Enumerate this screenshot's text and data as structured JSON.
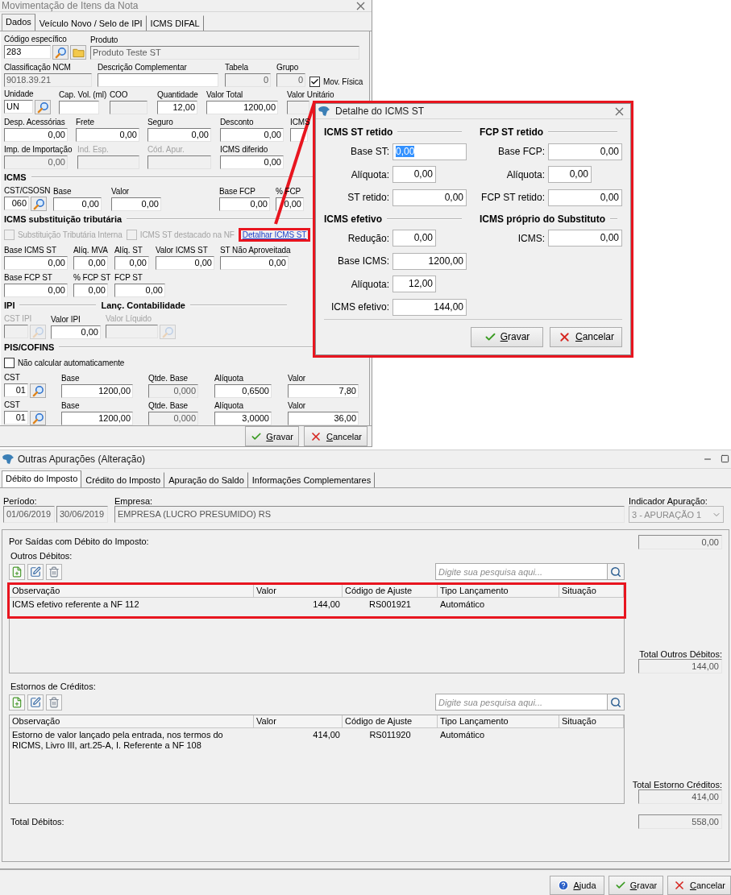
{
  "item_window": {
    "title": "Movimentação de Itens da Nota",
    "tabs": [
      {
        "label": "Dados",
        "selected": true
      },
      {
        "label": "Veículo Novo / Selo de IPI",
        "selected": false
      },
      {
        "label": "ICMS DIFAL",
        "selected": false
      }
    ],
    "content": [
      {
        "kind": "row",
        "fields": [
          {
            "kind": "lookup_folder",
            "label": "Código específico",
            "value": "283",
            "disabled": false,
            "muted": false
          },
          {
            "kind": "text",
            "label": "Produto",
            "value": "Produto Teste ST",
            "disabled": true,
            "muted": false
          }
        ]
      },
      {
        "kind": "row",
        "fields": [
          {
            "kind": "text",
            "label": "Classificação NCM",
            "value": "9018.39.21",
            "disabled": true,
            "muted": false
          },
          {
            "kind": "text",
            "label": "Descrição Complementar",
            "disabled": false,
            "muted": false
          },
          {
            "kind": "number",
            "label": "Tabela",
            "value": "0",
            "disabled": true,
            "muted": false
          },
          {
            "kind": "number",
            "label": "Grupo",
            "value": "0",
            "disabled": true,
            "muted": false
          },
          {
            "kind": "checkbox",
            "label": "Mov. Física",
            "checked": true,
            "disabled": false
          }
        ]
      },
      {
        "kind": "row",
        "fields": [
          {
            "kind": "lookup",
            "label": "Unidade",
            "value": "UN",
            "disabled": false,
            "muted": false
          },
          {
            "kind": "text",
            "label": "Cap. Vol. (ml)",
            "disabled": false,
            "muted": false
          },
          {
            "kind": "text",
            "label": "COO",
            "disabled": true,
            "muted": false
          },
          {
            "kind": "number",
            "label": "Quantidade",
            "value": "12,00",
            "disabled": false,
            "muted": false
          },
          {
            "kind": "number",
            "label": "Valor Total",
            "value": "1200,00",
            "disabled": false,
            "muted": false
          },
          {
            "kind": "number",
            "label": "Valor Unitário",
            "disabled": true,
            "muted": false
          }
        ]
      },
      {
        "kind": "row",
        "fields": [
          {
            "kind": "number",
            "label": "Desp. Acessórias",
            "value": "0,00",
            "disabled": false,
            "muted": false
          },
          {
            "kind": "number",
            "label": "Frete",
            "value": "0,00",
            "disabled": false,
            "muted": false
          },
          {
            "kind": "number",
            "label": "Seguro",
            "value": "0,00",
            "disabled": false,
            "muted": false
          },
          {
            "kind": "number",
            "label": "Desconto",
            "value": "0,00",
            "disabled": false,
            "muted": false
          },
          {
            "kind": "number",
            "label": "ICMS",
            "disabled": false,
            "muted": false
          }
        ]
      },
      {
        "kind": "row",
        "fields": [
          {
            "kind": "number",
            "label": "Imp. de Importação",
            "value": "0,00",
            "disabled": true,
            "muted": false
          },
          {
            "kind": "text",
            "label": "Ind. Esp.",
            "disabled": true,
            "muted": true
          },
          {
            "kind": "text",
            "label": "Cód. Apur.",
            "disabled": true,
            "muted": true
          },
          {
            "kind": "number",
            "label": "ICMS diferido",
            "value": "0,00",
            "disabled": false,
            "muted": false
          }
        ]
      },
      {
        "kind": "section",
        "title": "ICMS"
      },
      {
        "kind": "row",
        "fields": [
          {
            "kind": "lookup",
            "label": "CST/CSOSN",
            "value": "060",
            "disabled": false,
            "muted": false
          },
          {
            "kind": "number",
            "label": "Base",
            "value": "0,00",
            "disabled": false,
            "muted": false
          },
          {
            "kind": "number",
            "label": "Valor",
            "value": "0,00",
            "disabled": false,
            "muted": false
          },
          {
            "kind": "number",
            "label": "Base FCP",
            "value": "0,00",
            "disabled": false,
            "muted": false
          },
          {
            "kind": "number",
            "label": "% FCP",
            "value": "0,00",
            "disabled": false,
            "muted": false
          }
        ]
      },
      {
        "kind": "section",
        "title": "ICMS substituição tributária"
      },
      {
        "kind": "options",
        "fields": [
          {
            "kind": "checkbox",
            "label": "Substituição Tributária Interna",
            "checked": false,
            "disabled": true
          },
          {
            "kind": "checkbox",
            "label": "ICMS ST destacado na NF",
            "checked": false,
            "disabled": true
          },
          {
            "kind": "link",
            "label": "Detalhar ICMS ST",
            "annotated": true
          }
        ]
      },
      {
        "kind": "row",
        "fields": [
          {
            "kind": "number",
            "label": "Base ICMS ST",
            "value": "0,00",
            "disabled": false,
            "muted": false
          },
          {
            "kind": "number",
            "label": "Alíq. MVA",
            "value": "0,00",
            "disabled": false,
            "muted": false
          },
          {
            "kind": "number",
            "label": "Alíq. ST",
            "value": "0,00",
            "disabled": false,
            "muted": false
          },
          {
            "kind": "number",
            "label": "Valor ICMS ST",
            "value": "0,00",
            "disabled": false,
            "muted": false
          },
          {
            "kind": "number",
            "label": "ST Não Aproveitada",
            "value": "0,00",
            "disabled": false,
            "muted": false
          }
        ]
      },
      {
        "kind": "row",
        "fields": [
          {
            "kind": "number",
            "label": "Base FCP ST",
            "value": "0,00",
            "disabled": false,
            "muted": false
          },
          {
            "kind": "number",
            "label": "% FCP ST",
            "value": "0,00",
            "disabled": false,
            "muted": false
          },
          {
            "kind": "number",
            "label": "FCP ST",
            "value": "0,00",
            "disabled": false,
            "muted": false
          }
        ]
      },
      {
        "kind": "section_pair",
        "titles": [
          "IPI",
          "Lanç. Contabilidade"
        ]
      },
      {
        "kind": "row",
        "fields": [
          {
            "kind": "lookup",
            "label": "CST IPI",
            "disabled": true,
            "muted": true
          },
          {
            "kind": "number",
            "label": "Valor IPI",
            "value": "0,00",
            "disabled": false,
            "muted": false
          },
          {
            "kind": "lookup",
            "label": "Valor Líquido",
            "disabled": true,
            "muted": true
          }
        ]
      },
      {
        "kind": "section",
        "title": "PIS/COFINS"
      },
      {
        "kind": "options",
        "fields": [
          {
            "kind": "checkbox",
            "label": "Não calcular automaticamente",
            "checked": false,
            "disabled": false
          }
        ]
      },
      {
        "kind": "row",
        "fields": [
          {
            "kind": "lookup",
            "label": "CST",
            "value": "01",
            "disabled": false,
            "muted": false
          },
          {
            "kind": "number",
            "label": "Base",
            "value": "1200,00",
            "disabled": false,
            "muted": false
          },
          {
            "kind": "number",
            "label": "Qtde. Base",
            "value": "0,000",
            "disabled": true,
            "muted": false
          },
          {
            "kind": "number",
            "label": "Alíquota",
            "value": "0,6500",
            "disabled": false,
            "muted": false
          },
          {
            "kind": "number",
            "label": "Valor",
            "value": "7,80",
            "disabled": false,
            "muted": false
          }
        ]
      },
      {
        "kind": "row",
        "fields": [
          {
            "kind": "lookup",
            "label": "CST",
            "value": "01",
            "disabled": false,
            "muted": false
          },
          {
            "kind": "number",
            "label": "Base",
            "value": "1200,00",
            "disabled": false,
            "muted": false
          },
          {
            "kind": "number",
            "label": "Qtde. Base",
            "value": "0,000",
            "disabled": true,
            "muted": false
          },
          {
            "kind": "number",
            "label": "Alíquota",
            "value": "3,0000",
            "disabled": false,
            "muted": false
          },
          {
            "kind": "number",
            "label": "Valor",
            "value": "36,00",
            "disabled": false,
            "muted": false
          }
        ]
      }
    ],
    "buttons": [
      {
        "kind": "save",
        "label": "Gravar"
      },
      {
        "kind": "cancel",
        "label": "Cancelar"
      }
    ]
  },
  "detail_dialog": {
    "title": "Detalhe do ICMS ST",
    "columns": [
      {
        "sections": [
          {
            "title": "ICMS ST retido",
            "fields": [
              {
                "label": "Base ST:",
                "value": "0,00",
                "kind": "amount",
                "selected": true
              },
              {
                "label": "Alíquota:",
                "value": "0,00",
                "kind": "percent",
                "selected": false
              },
              {
                "label": "ST retido:",
                "value": "0,00",
                "kind": "amount",
                "selected": false
              }
            ]
          },
          {
            "title": "ICMS efetivo",
            "fields": [
              {
                "label": "Redução:",
                "value": "0,00",
                "kind": "percent",
                "selected": false
              },
              {
                "label": "Base ICMS:",
                "value": "1200,00",
                "kind": "amount",
                "selected": false
              },
              {
                "label": "Alíquota:",
                "value": "12,00",
                "kind": "percent",
                "selected": false
              },
              {
                "label": "ICMS efetivo:",
                "value": "144,00",
                "kind": "amount",
                "selected": false
              }
            ]
          }
        ]
      },
      {
        "sections": [
          {
            "title": "FCP ST retido",
            "fields": [
              {
                "label": "Base FCP:",
                "value": "0,00",
                "kind": "amount",
                "selected": false
              },
              {
                "label": "Alíquota:",
                "value": "0,00",
                "kind": "percent",
                "selected": false
              },
              {
                "label": "FCP ST retido:",
                "value": "0,00",
                "kind": "amount",
                "selected": false
              }
            ]
          },
          {
            "title": "ICMS próprio do Substituto",
            "fields": [
              {
                "label": "ICMS:",
                "value": "0,00",
                "kind": "amount",
                "selected": false
              }
            ]
          }
        ]
      }
    ],
    "buttons": [
      {
        "kind": "save",
        "label": "Gravar"
      },
      {
        "kind": "cancel",
        "label": "Cancelar"
      }
    ]
  },
  "apuracao_window": {
    "title": "Outras Apurações (Alteração)",
    "tabs": [
      {
        "label": "Débito do Imposto",
        "selected": true
      },
      {
        "label": "Crédito do Imposto",
        "selected": false
      },
      {
        "label": "Apuração do Saldo",
        "selected": false
      },
      {
        "label": "Informações Complementares",
        "selected": false
      }
    ],
    "periodo": {
      "label": "Período:",
      "start": "01/06/2019",
      "end": "30/06/2019"
    },
    "empresa": {
      "label": "Empresa:",
      "value": "EMPRESA (LUCRO PRESUMIDO) RS"
    },
    "indicador": {
      "label": "Indicador Apuração:",
      "value": "3 - APURAÇÃO 1"
    },
    "heading": "Por Saídas com Débito do Imposto:",
    "heading_total": "0,00",
    "groups": [
      {
        "label": "Outros Débitos:",
        "search_placeholder": "Digite sua pesquisa aqui...",
        "columns": [
          "Observação",
          "Valor",
          "Código de Ajuste",
          "Tipo Lançamento",
          "Situação"
        ],
        "rows": [
          {
            "cells": [
              "ICMS efetivo referente a NF 112",
              "144,00",
              "RS001921",
              "Automático"
            ]
          }
        ],
        "annotated": true,
        "total_label": "Total Outros Débitos:",
        "total": "144,00"
      },
      {
        "label": "Estornos de Créditos:",
        "search_placeholder": "Digite sua pesquisa aqui...",
        "columns": [
          "Observação",
          "Valor",
          "Código de Ajuste",
          "Tipo Lançamento",
          "Situação"
        ],
        "rows": [
          {
            "cells": [
              "Estorno de valor lançado pela entrada, nos termos do RICMS, Livro III, art.25-A, I. Referente a NF 108",
              "414,00",
              "RS011920",
              "Automático"
            ]
          }
        ],
        "annotated": false,
        "total_label": "Total Estorno Créditos:",
        "total": "414,00"
      }
    ],
    "total_label": "Total Débitos:",
    "total": "558,00",
    "buttons": [
      {
        "kind": "help",
        "label": "Ajuda"
      },
      {
        "kind": "save",
        "label": "Gravar"
      },
      {
        "kind": "cancel",
        "label": "Cancelar"
      }
    ]
  }
}
